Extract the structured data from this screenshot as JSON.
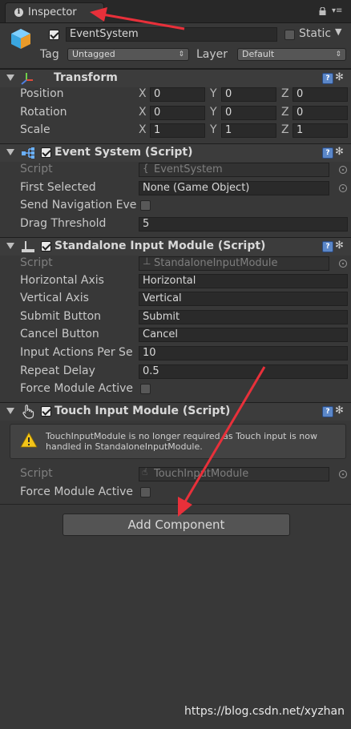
{
  "tab": {
    "title": "Inspector"
  },
  "gameobject": {
    "active": true,
    "name": "EventSystem",
    "static_label": "Static",
    "static_checked": false,
    "tag_label": "Tag",
    "tag_value": "Untagged",
    "layer_label": "Layer",
    "layer_value": "Default"
  },
  "transform": {
    "title": "Transform",
    "rows": [
      {
        "label": "Position",
        "x": "0",
        "y": "0",
        "z": "0"
      },
      {
        "label": "Rotation",
        "x": "0",
        "y": "0",
        "z": "0"
      },
      {
        "label": "Scale",
        "x": "1",
        "y": "1",
        "z": "1"
      }
    ],
    "axis_x": "X",
    "axis_y": "Y",
    "axis_z": "Z"
  },
  "event_system": {
    "title": "Event System (Script)",
    "script_label": "Script",
    "script_value": "EventSystem",
    "first_selected_label": "First Selected",
    "first_selected_value": "None (Game Object)",
    "send_nav_label": "Send Navigation Eve",
    "drag_threshold_label": "Drag Threshold",
    "drag_threshold_value": "5"
  },
  "standalone": {
    "title": "Standalone Input Module (Script)",
    "script_label": "Script",
    "script_value": "StandaloneInputModule",
    "horizontal_label": "Horizontal Axis",
    "horizontal_value": "Horizontal",
    "vertical_label": "Vertical Axis",
    "vertical_value": "Vertical",
    "submit_label": "Submit Button",
    "submit_value": "Submit",
    "cancel_label": "Cancel Button",
    "cancel_value": "Cancel",
    "input_actions_label": "Input Actions Per Se",
    "input_actions_value": "10",
    "repeat_delay_label": "Repeat Delay",
    "repeat_delay_value": "0.5",
    "force_label": "Force Module Active"
  },
  "touch": {
    "title": "Touch Input Module (Script)",
    "warning": "TouchInputModule is no longer required as Touch input is now handled in StandaloneInputModule.",
    "script_label": "Script",
    "script_value": "TouchInputModule",
    "force_label": "Force Module Active"
  },
  "add_component": "Add Component",
  "watermark": "https://blog.csdn.net/xyzhan",
  "colors": {
    "panel": "#383838",
    "annotation_arrow": "#e8303a",
    "help_blue": "#5b87c8"
  }
}
